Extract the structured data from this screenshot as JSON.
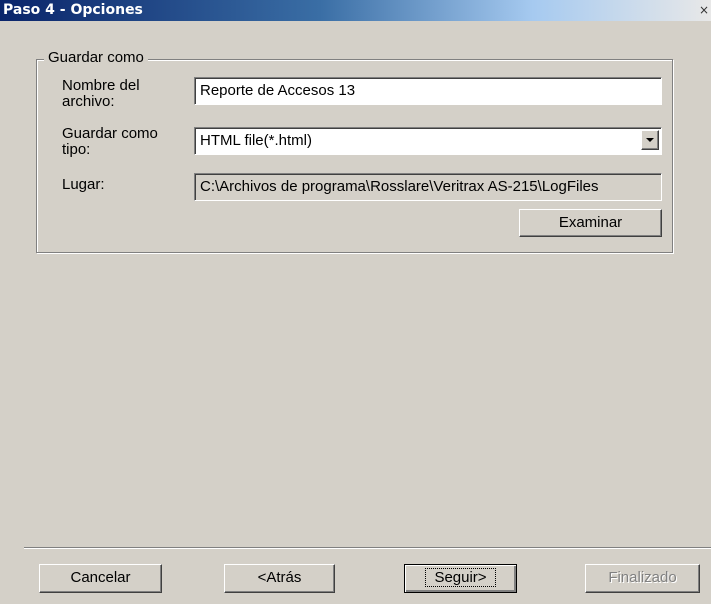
{
  "window": {
    "title": "Paso 4 - Opciones",
    "close_glyph": "×"
  },
  "group": {
    "legend": "Guardar como",
    "filename": {
      "label_line1": "Nombre del",
      "label_line2": "archivo:",
      "value": "Reporte de Accesos 13"
    },
    "filetype": {
      "label_line1": "Guardar como",
      "label_line2": "tipo:",
      "value": "HTML file(*.html)"
    },
    "location": {
      "label": "Lugar:",
      "value": "C:\\Archivos de programa\\Rosslare\\Veritrax AS-215\\LogFiles"
    },
    "browse_label": "Examinar"
  },
  "footer": {
    "cancel_label": "Cancelar",
    "back_label": "<Atrás",
    "next_label": "Seguir>",
    "finish_label": "Finalizado"
  },
  "colors": {
    "face": "#d4d0c8",
    "titlebar_start": "#0a246a",
    "titlebar_end": "#e8e8e8",
    "disabled_text": "#808080"
  }
}
